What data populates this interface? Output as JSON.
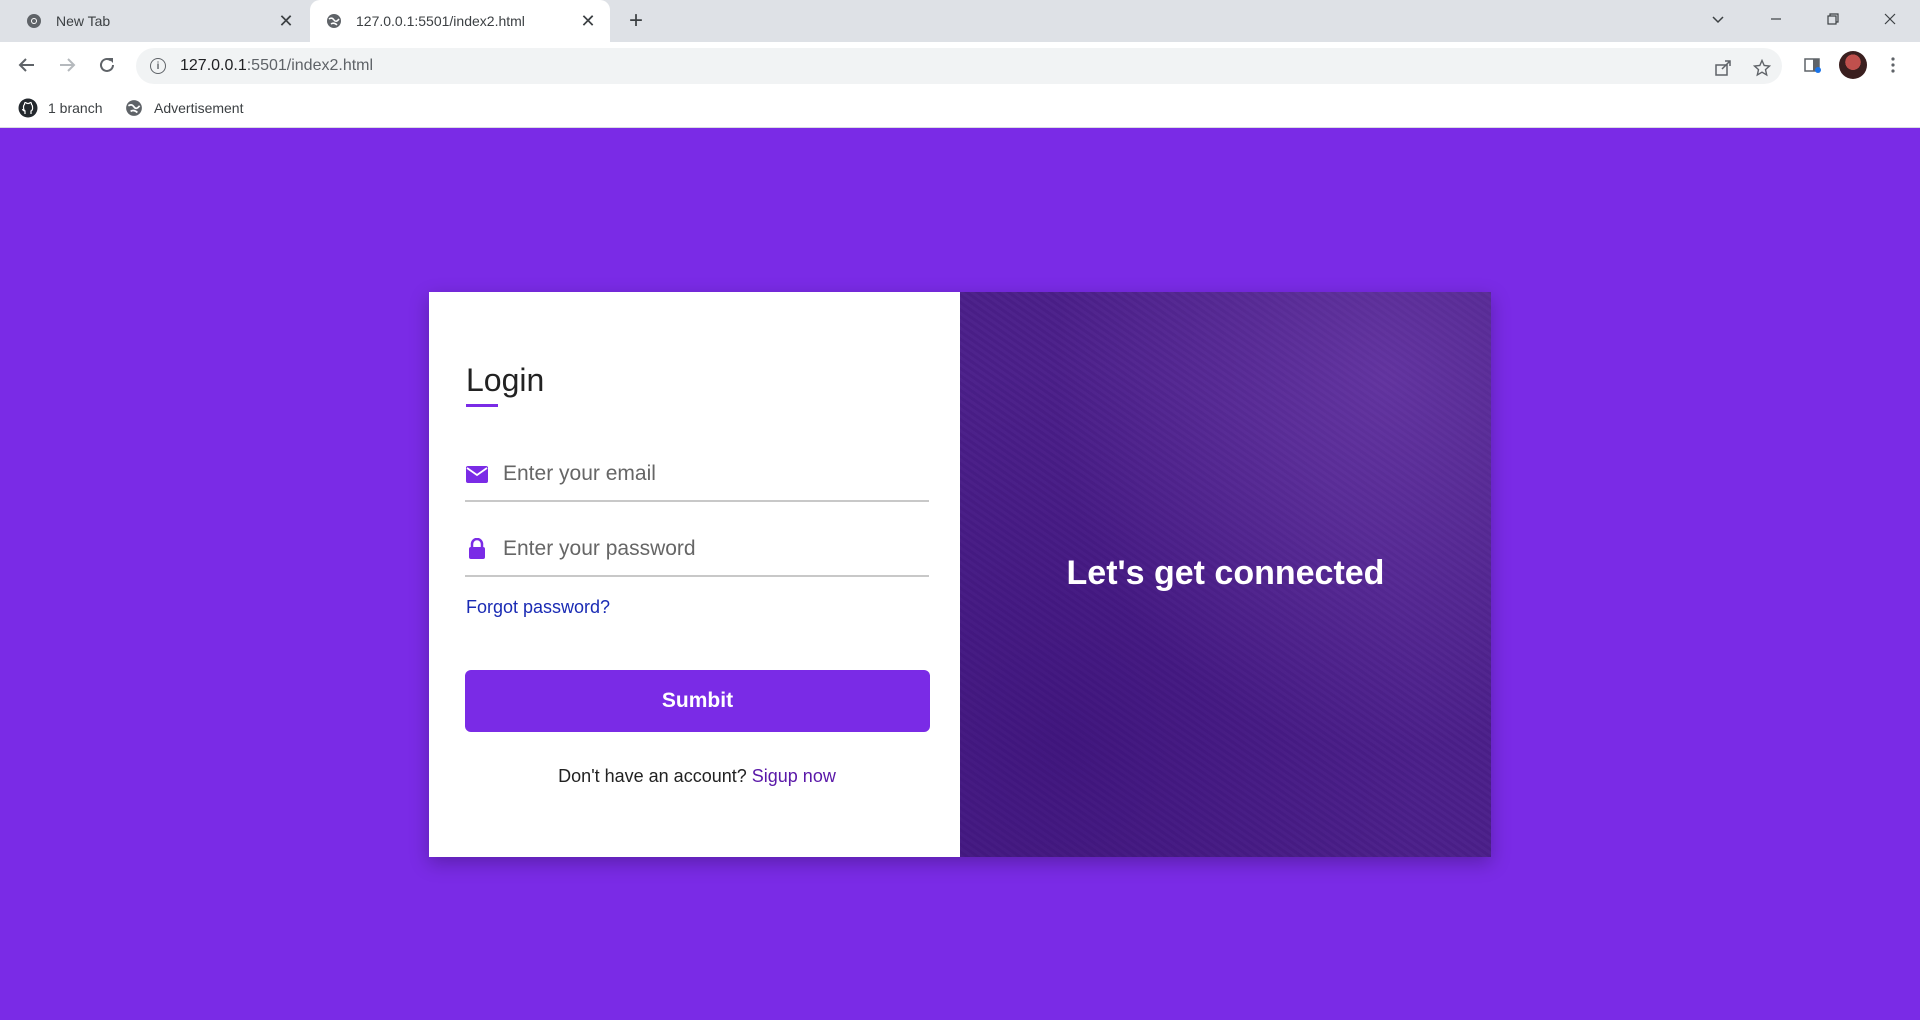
{
  "browser": {
    "tabs": [
      {
        "title": "New Tab",
        "icon": "chrome-icon",
        "active": false
      },
      {
        "title": "127.0.0.1:5501/index2.html",
        "icon": "globe-icon",
        "active": true
      }
    ],
    "address": {
      "host": "127.0.0.1",
      "path": ":5501/index2.html"
    },
    "bookmarks": [
      {
        "label": "1 branch",
        "icon": "github-icon"
      },
      {
        "label": "Advertisement",
        "icon": "globe-icon"
      }
    ]
  },
  "login": {
    "title": "Login",
    "email_placeholder": "Enter your email",
    "password_placeholder": "Enter your password",
    "forgot_label": "Forgot password?",
    "submit_label": "Sumbit",
    "signup_prompt": "Don't have an account?",
    "signup_link": "Sigup now"
  },
  "promo": {
    "tagline": "Let's get connected"
  },
  "colors": {
    "accent": "#7a2be6",
    "panel": "#4b1f8a",
    "link": "#1a2bb4"
  }
}
